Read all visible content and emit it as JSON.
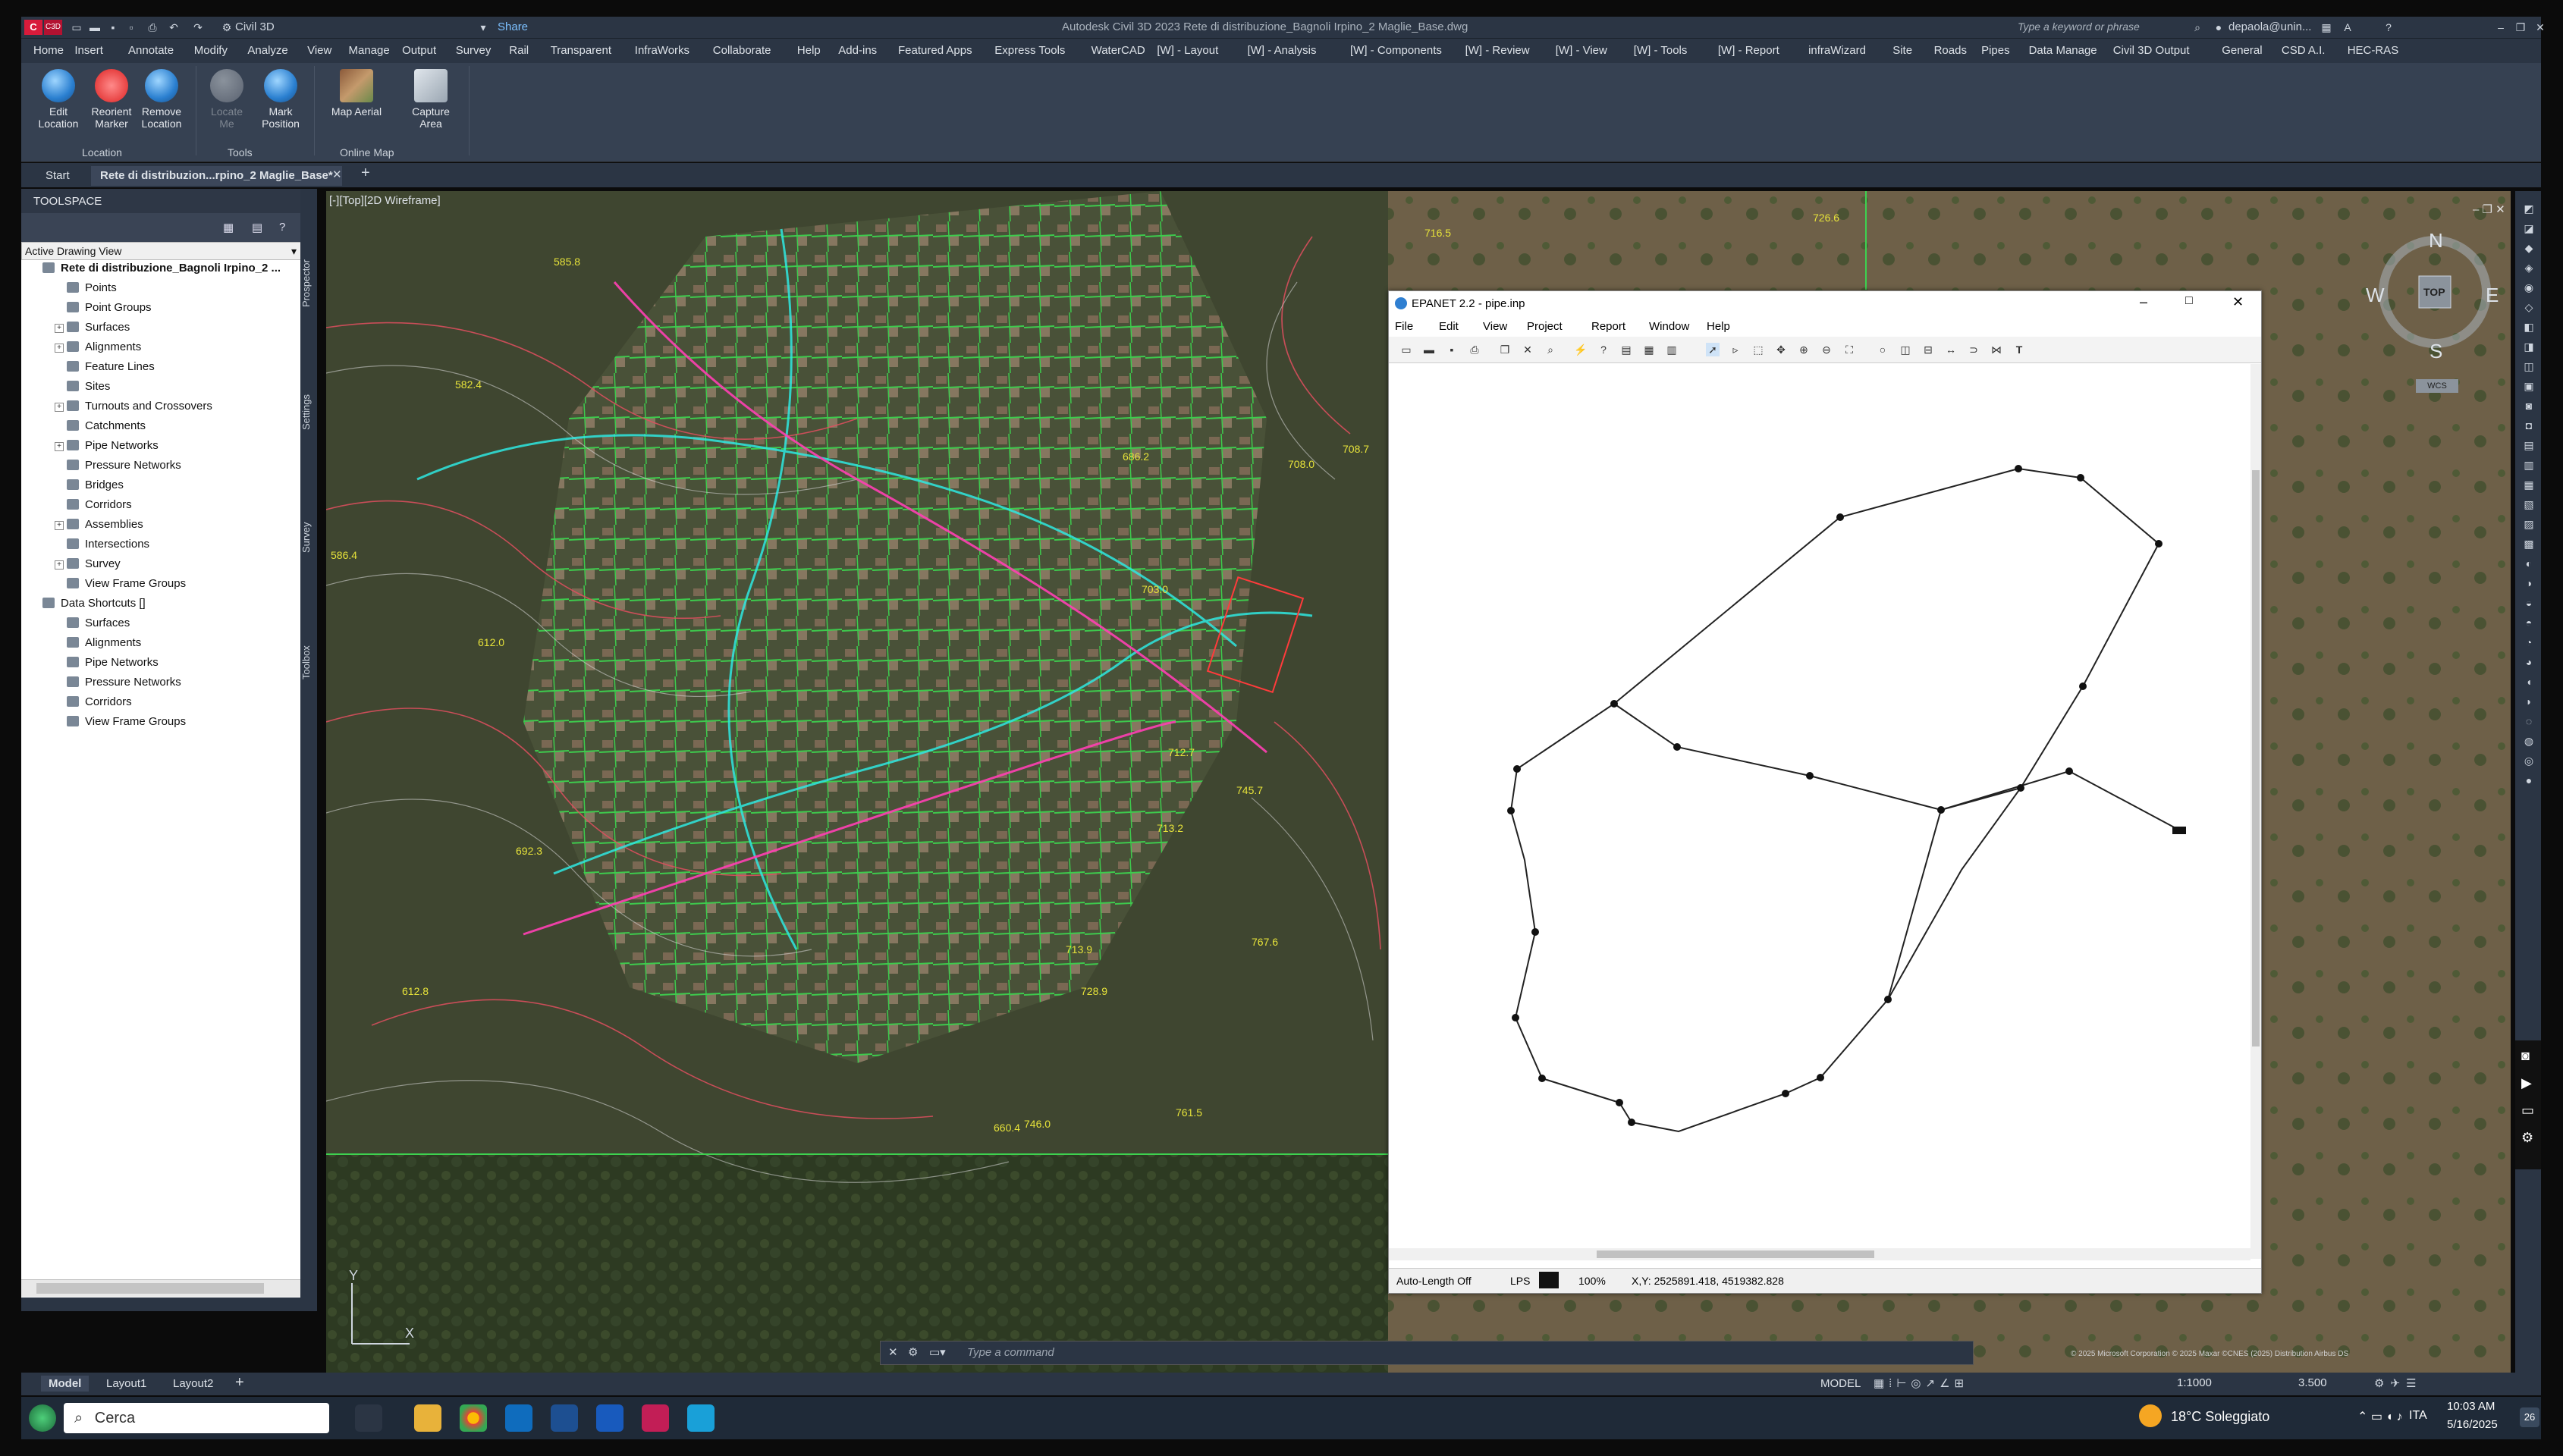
{
  "titlebar": {
    "app_name": "Civil 3D",
    "share": "Share",
    "title": "Autodesk Civil 3D 2023   Rete di distribuzione_Bagnoli Irpino_2 Maglie_Base.dwg",
    "search_placeholder": "Type a keyword or phrase",
    "user": "depaola@unin..."
  },
  "menu": [
    "Home",
    "Insert",
    "Annotate",
    "Modify",
    "Analyze",
    "View",
    "Manage",
    "Output",
    "Survey",
    "Rail",
    "Transparent",
    "InfraWorks",
    "Collaborate",
    "Help",
    "Add-ins",
    "Featured Apps",
    "Express Tools",
    "WaterCAD",
    "[W] - Layout",
    "[W] - Analysis",
    "[W] - Components",
    "[W] - Review",
    "[W] - View",
    "[W] - Tools",
    "[W] - Report",
    "infraWizard",
    "Site",
    "Roads",
    "Pipes",
    "Data Manage",
    "Civil 3D Output",
    "General",
    "CSD A.I.",
    "HEC-RAS"
  ],
  "ribbon": {
    "buttons": [
      {
        "label1": "Edit",
        "label2": "Location"
      },
      {
        "label1": "Reorient",
        "label2": "Marker"
      },
      {
        "label1": "Remove",
        "label2": "Location"
      },
      {
        "label1": "Locate",
        "label2": "Me"
      },
      {
        "label1": "Mark",
        "label2": "Position"
      },
      {
        "label1": "Map Aerial",
        "label2": ""
      },
      {
        "label1": "Capture",
        "label2": "Area"
      }
    ],
    "panels": [
      "Location",
      "Tools",
      "Online Map"
    ]
  },
  "doctabs": {
    "start": "Start",
    "active": "Rete di distribuzion...rpino_2 Maglie_Base*"
  },
  "toolspace": {
    "header": "TOOLSPACE",
    "dropdown": "Active Drawing View",
    "root": "Rete di distribuzione_Bagnoli Irpino_2 ...",
    "items": [
      "Points",
      "Point Groups",
      "Surfaces",
      "Alignments",
      "Feature Lines",
      "Sites",
      "Turnouts and Crossovers",
      "Catchments",
      "Pipe Networks",
      "Pressure Networks",
      "Bridges",
      "Corridors",
      "Assemblies",
      "Intersections",
      "Survey",
      "View Frame Groups"
    ],
    "shortcuts_root": "Data Shortcuts []",
    "shortcuts": [
      "Surfaces",
      "Alignments",
      "Pipe Networks",
      "Pressure Networks",
      "Corridors",
      "View Frame Groups"
    ],
    "vtabs": [
      "Prospector",
      "Settings",
      "Survey",
      "Toolbox"
    ]
  },
  "viewport": {
    "label": "[-][Top][2D Wireframe]"
  },
  "contour_labels": [
    "585.8",
    "582.4",
    "586.4",
    "612.0",
    "692.3",
    "612.8",
    "712.7",
    "708.0",
    "660.4",
    "726.6",
    "716.5",
    "708.7",
    "703.0",
    "713.2",
    "686.2",
    "713.9",
    "728.9",
    "745.7",
    "746.0",
    "761.5",
    "767.6"
  ],
  "epanet": {
    "title": "EPANET 2.2 - pipe.inp",
    "menu": [
      "File",
      "Edit",
      "View",
      "Project",
      "Report",
      "Window",
      "Help"
    ],
    "status": {
      "autolength": "Auto-Length Off",
      "units": "LPS",
      "zoom": "100%",
      "xy": "X,Y: 2525891.418, 4519382.828"
    }
  },
  "compass": {
    "n": "N",
    "s": "S",
    "e": "E",
    "w": "W",
    "top": "TOP",
    "wcs": "WCS"
  },
  "command": {
    "placeholder": "Type a command"
  },
  "layouts": [
    "Model",
    "Layout1",
    "Layout2"
  ],
  "status": {
    "model": "MODEL",
    "scale": "1:1000",
    "value": "3.500"
  },
  "taskbar": {
    "search": "Cerca",
    "weather": "18°C  Soleggiato",
    "lang": "ITA",
    "time": "10:03 AM",
    "date": "5/16/2025",
    "notif": "26"
  },
  "copyright": "© 2025 Microsoft Corporation © 2025 Maxar ©CNES (2025) Distribution Airbus DS"
}
